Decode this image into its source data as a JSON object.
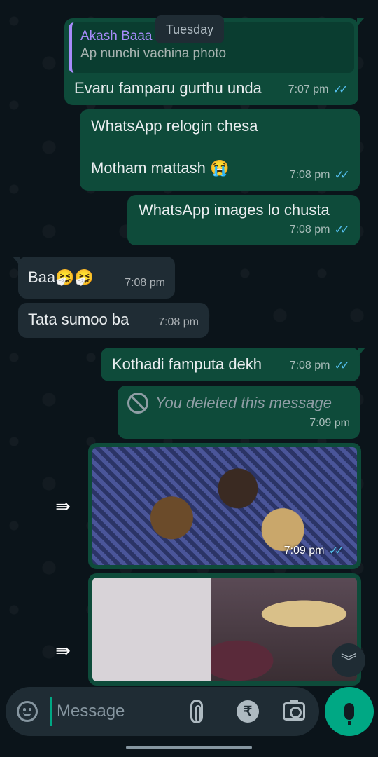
{
  "date_chip": "Tuesday",
  "messages": [
    {
      "quote_author": "Akash Baaa",
      "quote_text": "Ap nunchi vachina photo",
      "text": "Evaru famparu gurthu unda",
      "time": "7:07 pm"
    },
    {
      "line1": "WhatsApp relogin chesa",
      "line2": "Motham mattash 😭",
      "time": "7:08 pm"
    },
    {
      "text": "WhatsApp images lo chusta",
      "time": "7:08 pm"
    },
    {
      "text": "Baa🤧🤧",
      "time": "7:08 pm"
    },
    {
      "text": "Tata sumoo ba",
      "time": "7:08 pm"
    },
    {
      "text": "Kothadi famputa dekh",
      "time": "7:08 pm"
    },
    {
      "text": "You deleted this message",
      "time": "7:09 pm"
    },
    {
      "time": "7:09 pm"
    }
  ],
  "input": {
    "placeholder": "Message"
  },
  "icons": {
    "read_ticks": "✓✓",
    "forward": "⇛",
    "scroll_down": "︾",
    "rupee": "₹"
  }
}
